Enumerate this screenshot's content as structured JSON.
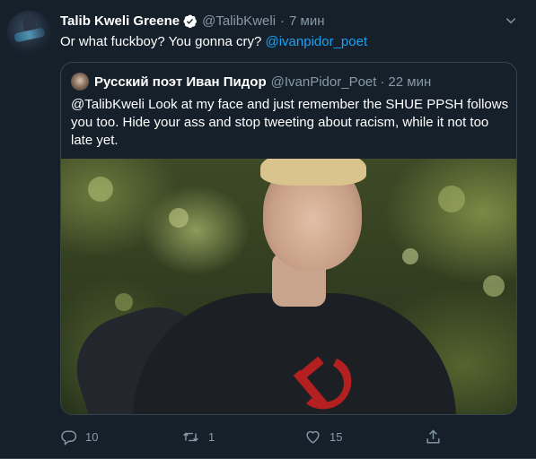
{
  "tweet": {
    "display_name": "Talib Kweli Greene",
    "handle": "@TalibKweli",
    "separator": "·",
    "time": "7 мин",
    "text": "Or what fuckboy? You gonna cry? ",
    "mention": "@ivanpidor_poet"
  },
  "quote": {
    "display_name": "Русский поэт Иван Пидор",
    "handle": "@IvanPidor_Poet",
    "separator": "·",
    "time": "22 мин",
    "text": "@TalibKweli Look at my face and just remember the SHUE PPSH follows you too. Hide your ass and stop tweeting about racism, while it not too late yet."
  },
  "actions": {
    "reply_count": "10",
    "retweet_count": "1",
    "like_count": "15"
  },
  "icons": {
    "verified": "verified-badge-icon",
    "caret": "chevron-down-icon",
    "reply": "reply-icon",
    "retweet": "retweet-icon",
    "like": "heart-icon",
    "share": "share-icon"
  },
  "colors": {
    "background": "#15202b",
    "accent": "#1da1f2",
    "secondary_text": "#8899a6",
    "border": "#38444d"
  }
}
